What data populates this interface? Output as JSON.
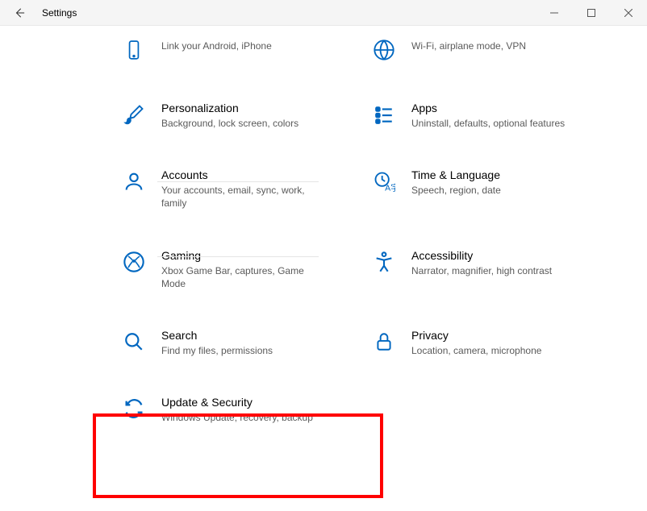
{
  "window": {
    "title": "Settings"
  },
  "tiles": {
    "phone": {
      "title": "",
      "sub": "Link your Android, iPhone"
    },
    "network": {
      "title": "",
      "sub": "Wi-Fi, airplane mode, VPN"
    },
    "personalization": {
      "title": "Personalization",
      "sub": "Background, lock screen, colors"
    },
    "apps": {
      "title": "Apps",
      "sub": "Uninstall, defaults, optional features"
    },
    "accounts": {
      "title": "Accounts",
      "sub": "Your accounts, email, sync, work, family"
    },
    "time": {
      "title": "Time & Language",
      "sub": "Speech, region, date"
    },
    "gaming": {
      "title": "Gaming",
      "sub": "Xbox Game Bar, captures, Game Mode"
    },
    "accessibility": {
      "title": "Accessibility",
      "sub": "Narrator, magnifier, high contrast"
    },
    "search": {
      "title": "Search",
      "sub": "Find my files, permissions"
    },
    "privacy": {
      "title": "Privacy",
      "sub": "Location, camera, microphone"
    },
    "update": {
      "title": "Update & Security",
      "sub": "Windows Update, recovery, backup"
    }
  },
  "colors": {
    "accent": "#0067c0",
    "highlight": "#ff0000"
  }
}
